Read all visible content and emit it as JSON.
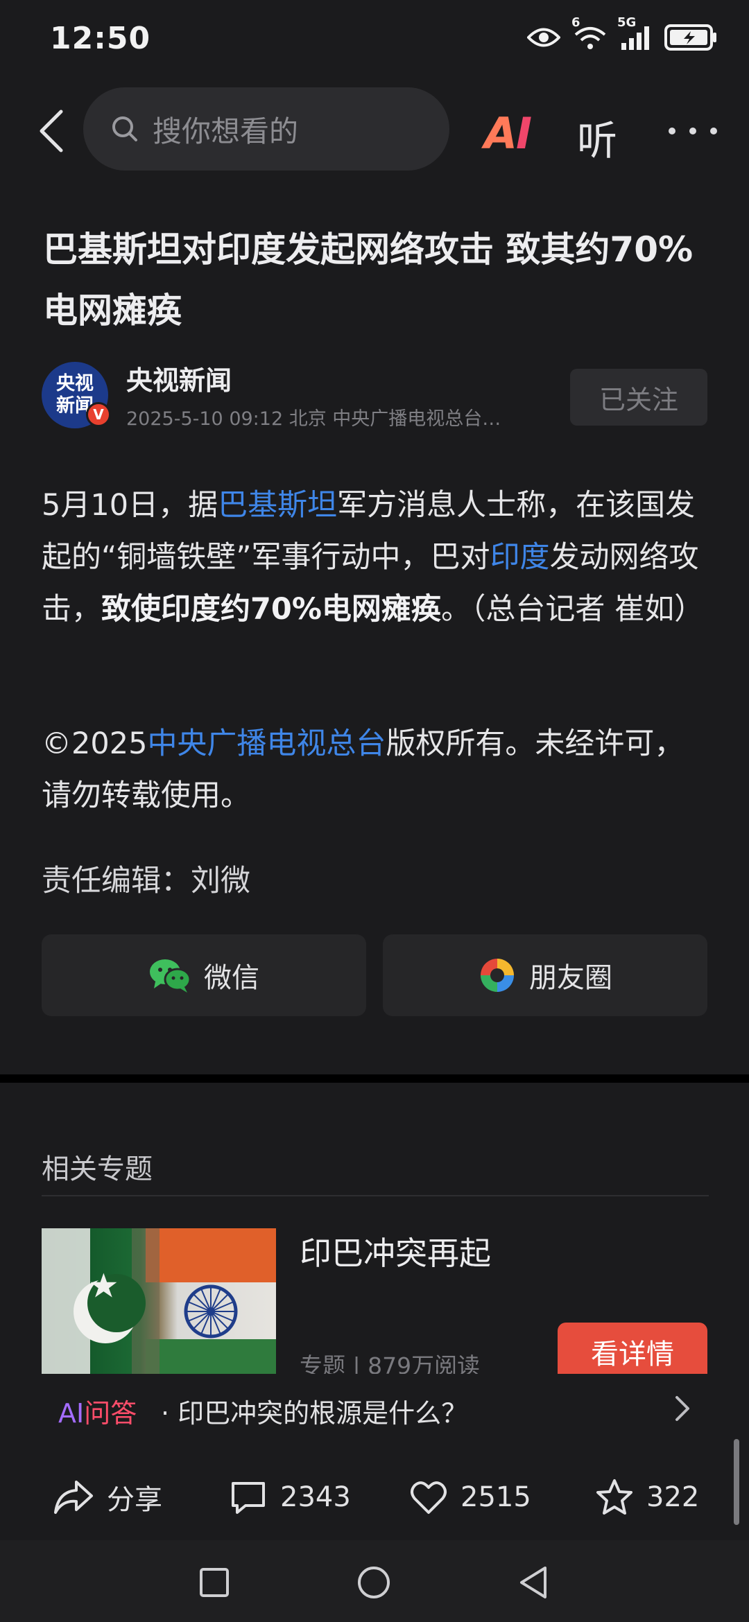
{
  "status_bar": {
    "time": "12:50",
    "network_label_1": "6",
    "network_label_2": "5G",
    "icons": [
      "eye-icon",
      "wifi-icon",
      "signal-icon",
      "battery-icon"
    ]
  },
  "header": {
    "search_placeholder": "搜你想看的",
    "ai_label_a": "A",
    "ai_label_i": "I",
    "listen_label": "听"
  },
  "article": {
    "title": "巴基斯坦对印度发起网络攻击 致其约70%电网瘫痪",
    "author": {
      "avatar_line1": "央视",
      "avatar_line2": "新闻",
      "verified_badge": "V",
      "name": "央视新闻",
      "meta": "2025-5-10  09:12  北京  中央广播电视总台…",
      "follow_label": "已关注"
    },
    "para1": {
      "t1": "5月10日，据",
      "link1": "巴基斯坦",
      "t2": "军方消息人士称，在该国发起的“铜墙铁壁”军事行动中，巴对",
      "link2": "印度",
      "t3": "发动网络攻击，",
      "bold": "致使印度约70%电网瘫痪",
      "t4": "。（总台记者 崔如）"
    },
    "para2": {
      "t1": "©2025",
      "link": "中央广播电视总台",
      "t2": "版权所有。未经许可，请勿转载使用。"
    },
    "editor": "责任编辑：刘微"
  },
  "share": {
    "wechat_label": "微信",
    "moments_label": "朋友圈"
  },
  "related": {
    "section_title": "相关专题",
    "topic_title": "印巴冲突再起",
    "topic_meta": "专题 | 879万阅读",
    "detail_button": "看详情",
    "ai_ask_prefix_ai": "AI",
    "ai_ask_prefix_rest": "问答",
    "ai_ask_question": "· 印巴冲突的根源是什么？"
  },
  "actions": {
    "share_label": "分享",
    "comments_count": "2343",
    "likes_count": "2515",
    "favorites_count": "322"
  },
  "colors": {
    "background": "#1b1b1d",
    "link": "#3f86e8",
    "detail_button": "#e64d3d",
    "ai_gradient_start": "#a46cff",
    "ai_gradient_end": "#ff4d6a"
  }
}
